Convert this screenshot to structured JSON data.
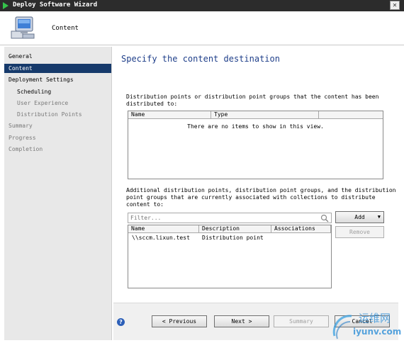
{
  "window": {
    "title": "Deploy Software Wizard",
    "close_glyph": "✕"
  },
  "header": {
    "step_name": "Content",
    "icon": "computer-icon"
  },
  "sidebar": {
    "items": [
      {
        "label": "General"
      },
      {
        "label": "Content"
      },
      {
        "label": "Deployment Settings"
      },
      {
        "label": "Scheduling"
      },
      {
        "label": "User Experience"
      },
      {
        "label": "Distribution Points"
      },
      {
        "label": "Summary"
      },
      {
        "label": "Progress"
      },
      {
        "label": "Completion"
      }
    ],
    "selected": "Content"
  },
  "main": {
    "heading": "Specify the content destination",
    "distributed_to": {
      "description_line1": "Distribution points or distribution point groups that the content has been",
      "description_line2": "distributed to:",
      "columns": [
        "Name",
        "Type"
      ],
      "empty_text": "There are no items to show in this view."
    },
    "additional": {
      "description_line1": "Additional distribution points, distribution point groups, and the distribution",
      "description_line2": "point groups that are currently associated with collections to distribute",
      "description_line3": "content to:",
      "filter_placeholder": "Filter...",
      "columns": [
        "Name",
        "Description",
        "Associations"
      ],
      "rows": [
        {
          "name": "\\\\sccm.lixun.test",
          "description": "Distribution point",
          "associations": ""
        }
      ],
      "add_label": "Add",
      "add_arrow": "▼",
      "remove_label": "Remove"
    }
  },
  "footer": {
    "help_glyph": "?",
    "previous_label": "< Previous",
    "next_label": "Next >",
    "summary_label": "Summary",
    "cancel_label": "Cancel"
  },
  "watermark": {
    "text1": "运维网",
    "text2": "iyunv.com"
  },
  "colors": {
    "selected_bg": "#163a6b",
    "heading": "#1f3f8a",
    "titlebar": "#2c2c2c"
  }
}
